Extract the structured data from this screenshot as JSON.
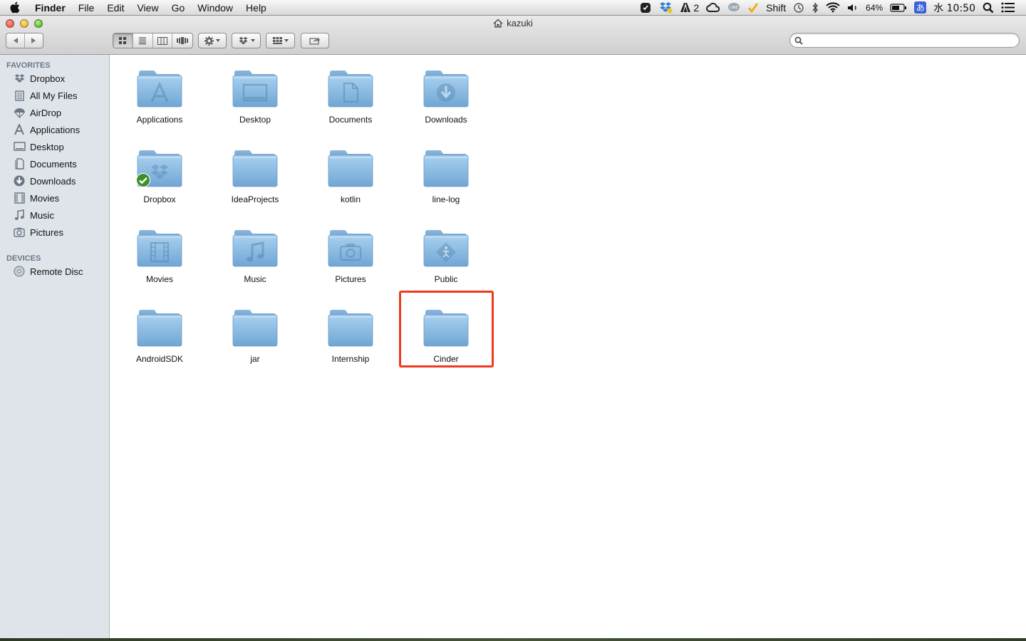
{
  "menubar": {
    "app": "Finder",
    "items": [
      "File",
      "Edit",
      "View",
      "Go",
      "Window",
      "Help"
    ],
    "status": {
      "adobe_count": "2",
      "input_source": "Shift",
      "battery": "64%",
      "ime": "あ",
      "clock": "水 10:50"
    }
  },
  "window": {
    "title": "kazuki",
    "search": {
      "value": "",
      "placeholder": ""
    }
  },
  "sidebar": {
    "favorites_header": "FAVORITES",
    "favorites": [
      {
        "label": "Dropbox",
        "icon": "dropbox-icon"
      },
      {
        "label": "All My Files",
        "icon": "all-files-icon"
      },
      {
        "label": "AirDrop",
        "icon": "airdrop-icon"
      },
      {
        "label": "Applications",
        "icon": "applications-icon"
      },
      {
        "label": "Desktop",
        "icon": "desktop-icon"
      },
      {
        "label": "Documents",
        "icon": "documents-icon"
      },
      {
        "label": "Downloads",
        "icon": "downloads-icon"
      },
      {
        "label": "Movies",
        "icon": "movies-icon"
      },
      {
        "label": "Music",
        "icon": "music-icon"
      },
      {
        "label": "Pictures",
        "icon": "pictures-icon"
      }
    ],
    "devices_header": "DEVICES",
    "devices": [
      {
        "label": "Remote Disc",
        "icon": "remote-disc-icon"
      }
    ]
  },
  "folders": [
    {
      "label": "Applications",
      "glyph": "applications"
    },
    {
      "label": "Desktop",
      "glyph": "desktop"
    },
    {
      "label": "Documents",
      "glyph": "documents"
    },
    {
      "label": "Downloads",
      "glyph": "downloads"
    },
    {
      "label": "Dropbox",
      "glyph": "dropbox"
    },
    {
      "label": "IdeaProjects",
      "glyph": "plain"
    },
    {
      "label": "kotlin",
      "glyph": "plain"
    },
    {
      "label": "line-log",
      "glyph": "plain"
    },
    {
      "label": "Movies",
      "glyph": "movies"
    },
    {
      "label": "Music",
      "glyph": "music"
    },
    {
      "label": "Pictures",
      "glyph": "pictures"
    },
    {
      "label": "Public",
      "glyph": "public"
    },
    {
      "label": "AndroidSDK",
      "glyph": "plain"
    },
    {
      "label": "jar",
      "glyph": "plain"
    },
    {
      "label": "Internship",
      "glyph": "plain"
    },
    {
      "label": "Cinder",
      "glyph": "plain"
    }
  ],
  "colors": {
    "highlight": "#ee3a1f",
    "sidebar_bg": "#dfe4ea",
    "folder": "#8dbbe0"
  }
}
